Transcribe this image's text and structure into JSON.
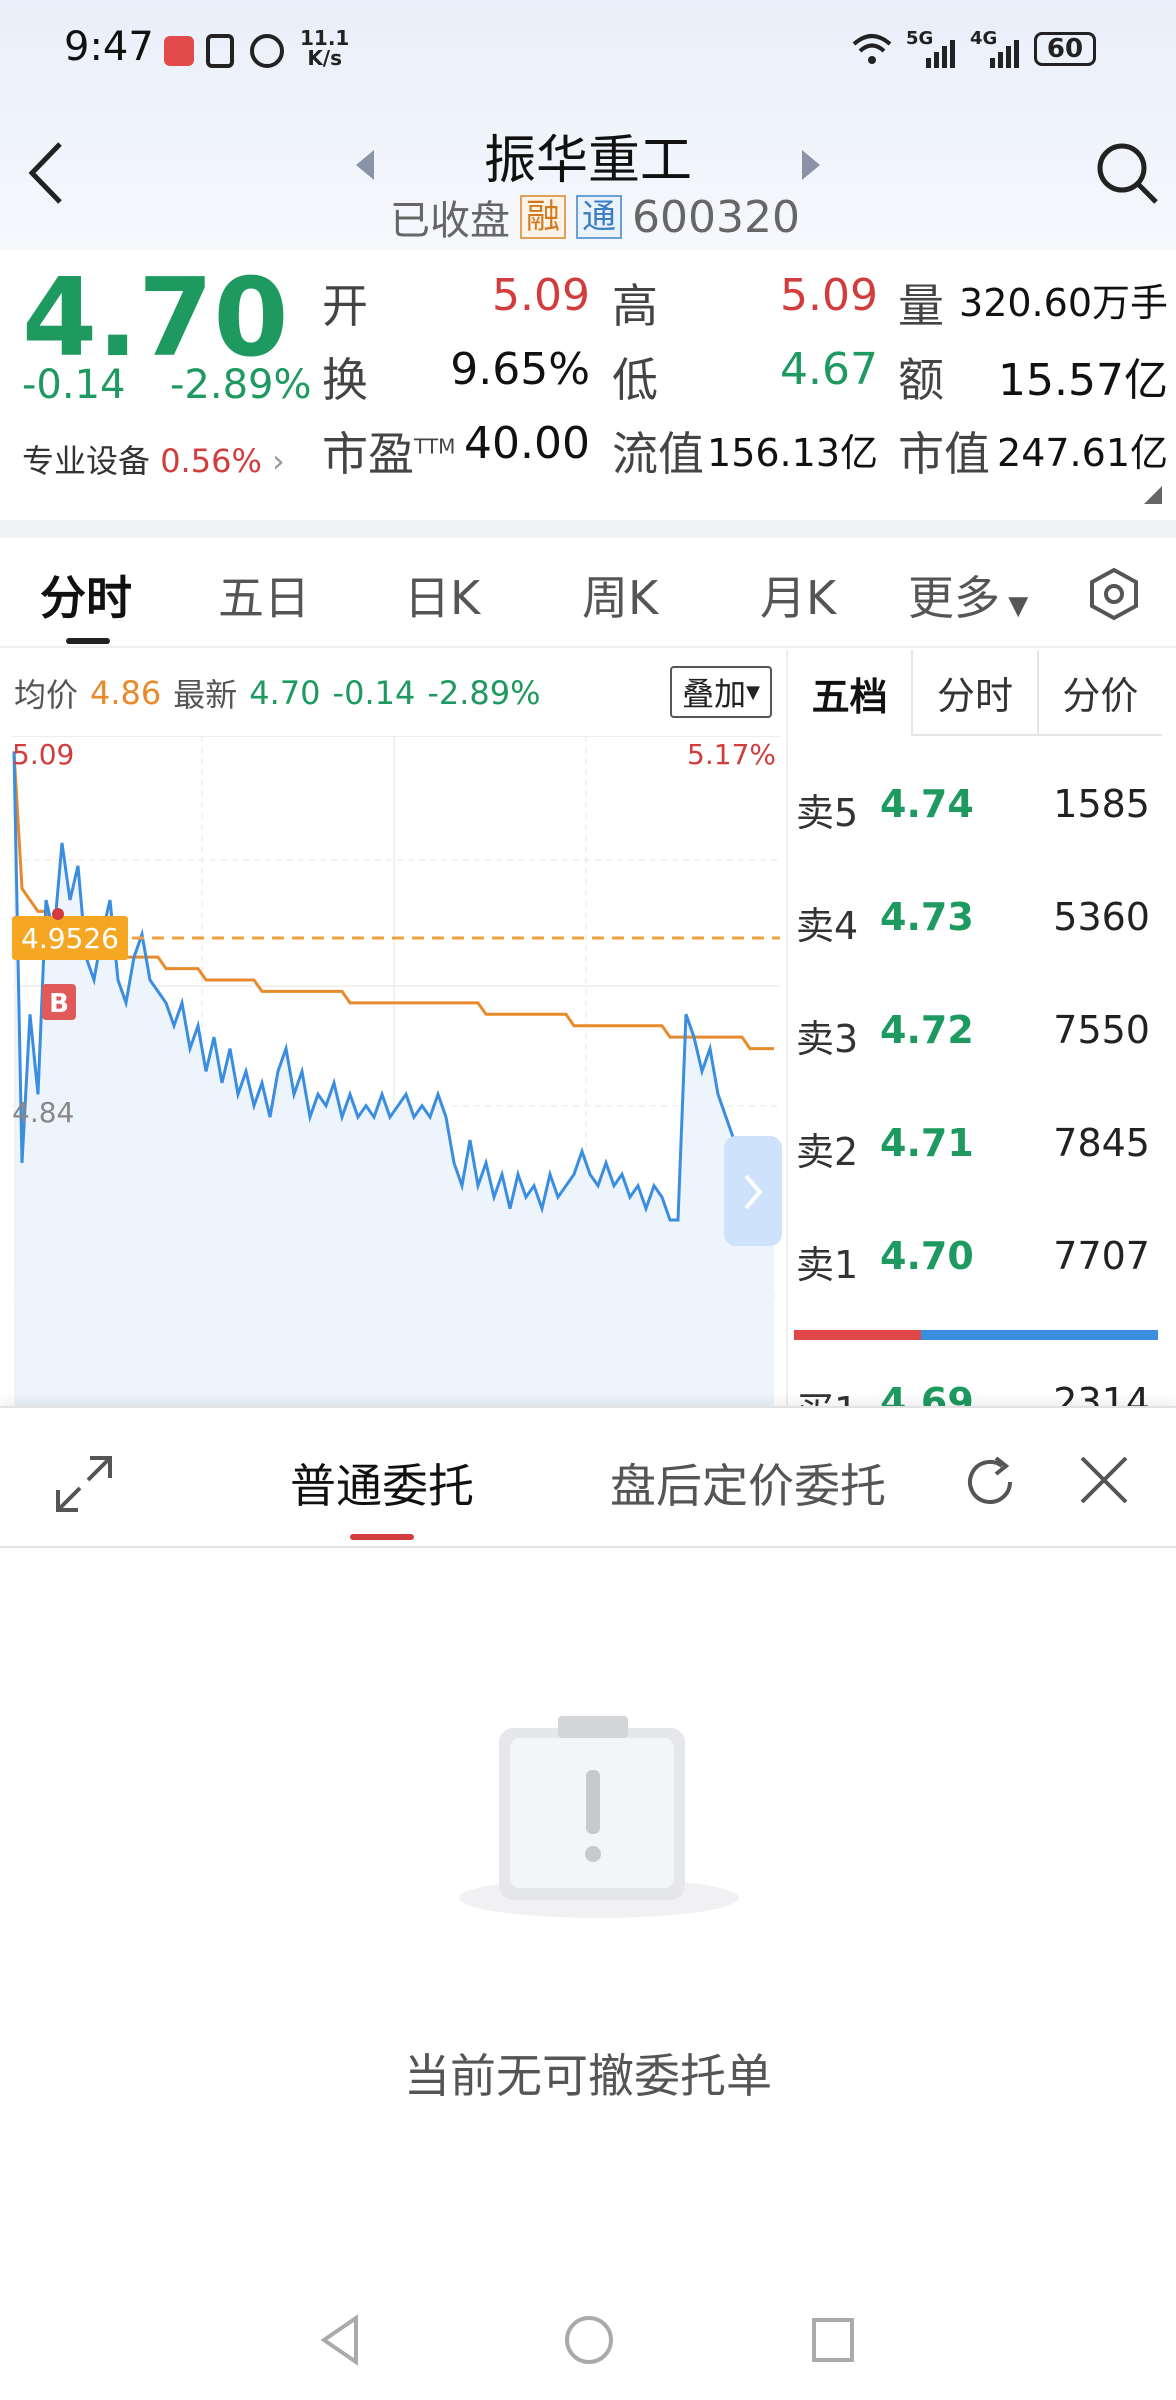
{
  "status": {
    "time": "9:47",
    "speed_value": "11.1",
    "speed_unit": "K/s",
    "battery": "60",
    "net1": "5G",
    "net2": "4G"
  },
  "header": {
    "title": "振华重工",
    "status": "已收盘",
    "tag1": "融",
    "tag2": "通",
    "code": "600320"
  },
  "quote": {
    "price": "4.70",
    "change": "-0.14",
    "change_pct": "-2.89%",
    "sector": "专业设备",
    "sector_pct": "0.56%",
    "items": [
      {
        "label": "开",
        "value": "5.09"
      },
      {
        "label": "高",
        "value": "5.09"
      },
      {
        "label": "量",
        "value": "320.60万手"
      },
      {
        "label": "换",
        "value": "9.65%"
      },
      {
        "label": "低",
        "value": "4.67"
      },
      {
        "label": "额",
        "value": "15.57亿"
      },
      {
        "label": "市盈",
        "sup": "TTM",
        "value": "40.00"
      },
      {
        "label": "流值",
        "value": "156.13亿"
      },
      {
        "label": "市值",
        "value": "247.61亿"
      }
    ]
  },
  "tabs": [
    "分时",
    "五日",
    "日K",
    "周K",
    "月K",
    "更多"
  ],
  "info": {
    "avg_label": "均价",
    "avg": "4.86",
    "last_label": "最新",
    "last": "4.70",
    "chg": "-0.14",
    "pct": "-2.89%",
    "overlay": "叠加"
  },
  "chart_data": {
    "type": "line",
    "y_top_label": "5.09",
    "y_mid_label": "4.84",
    "pct_top_label": "5.17%",
    "marker_label": "4.9526",
    "marker_tag": "B",
    "ylim": [
      4.6,
      5.09
    ],
    "series": [
      {
        "values": [
          5.08,
          4.72,
          4.85,
          4.78,
          4.95,
          4.92,
          5.0,
          4.95,
          4.98,
          4.9,
          4.88,
          4.92,
          4.95,
          4.88,
          4.86,
          4.9,
          4.92,
          4.88,
          4.87,
          4.86,
          4.84,
          4.86,
          4.82,
          4.84,
          4.8,
          4.83,
          4.79,
          4.82,
          4.78,
          4.8,
          4.77,
          4.79,
          4.76,
          4.8,
          4.82,
          4.78,
          4.8,
          4.76,
          4.78,
          4.77,
          4.79,
          4.76,
          4.78,
          4.76,
          4.77,
          4.76,
          4.78,
          4.76,
          4.77,
          4.78,
          4.76,
          4.77,
          4.76,
          4.78,
          4.76,
          4.72,
          4.7,
          4.74,
          4.7,
          4.72,
          4.69,
          4.71,
          4.68,
          4.71,
          4.69,
          4.7,
          4.68,
          4.71,
          4.69,
          4.7,
          4.71,
          4.73,
          4.71,
          4.7,
          4.72,
          4.7,
          4.71,
          4.69,
          4.7,
          4.68,
          4.7,
          4.69,
          4.67,
          4.67,
          4.85,
          4.83,
          4.8,
          4.82,
          4.78,
          4.76,
          4.74,
          4.72,
          4.71,
          4.72,
          4.7,
          4.71
        ]
      },
      {
        "values": [
          5.08,
          4.96,
          4.95,
          4.94,
          4.94,
          4.93,
          4.93,
          4.93,
          4.92,
          4.92,
          4.92,
          4.91,
          4.91,
          4.91,
          4.9,
          4.9,
          4.9,
          4.9,
          4.9,
          4.89,
          4.89,
          4.89,
          4.89,
          4.89,
          4.88,
          4.88,
          4.88,
          4.88,
          4.88,
          4.88,
          4.88,
          4.87,
          4.87,
          4.87,
          4.87,
          4.87,
          4.87,
          4.87,
          4.87,
          4.87,
          4.87,
          4.87,
          4.86,
          4.86,
          4.86,
          4.86,
          4.86,
          4.86,
          4.86,
          4.86,
          4.86,
          4.86,
          4.86,
          4.86,
          4.86,
          4.86,
          4.86,
          4.86,
          4.86,
          4.85,
          4.85,
          4.85,
          4.85,
          4.85,
          4.85,
          4.85,
          4.85,
          4.85,
          4.85,
          4.85,
          4.84,
          4.84,
          4.84,
          4.84,
          4.84,
          4.84,
          4.84,
          4.84,
          4.84,
          4.84,
          4.84,
          4.84,
          4.83,
          4.83,
          4.83,
          4.83,
          4.83,
          4.83,
          4.83,
          4.83,
          4.83,
          4.83,
          4.82,
          4.82,
          4.82,
          4.82
        ]
      }
    ]
  },
  "book": {
    "tabs": [
      "五档",
      "分时",
      "分价"
    ],
    "rows": [
      {
        "name": "卖5",
        "price": "4.74",
        "vol": "1585"
      },
      {
        "name": "卖4",
        "price": "4.73",
        "vol": "5360"
      },
      {
        "name": "卖3",
        "price": "4.72",
        "vol": "7550"
      },
      {
        "name": "卖2",
        "price": "4.71",
        "vol": "7845"
      },
      {
        "name": "卖1",
        "price": "4.70",
        "vol": "7707"
      },
      {
        "name": "买1",
        "price": "4.69",
        "vol": "2314"
      }
    ],
    "sell_ratio": 0.35
  },
  "sheet": {
    "tab1": "普通委托",
    "tab2": "盘后定价委托",
    "empty_text": "当前无可撤委托单"
  },
  "colors": {
    "up": "#d23c3c",
    "down": "#1e9a60",
    "price_line": "#3b8de0",
    "avg_line": "#e88a2c"
  }
}
